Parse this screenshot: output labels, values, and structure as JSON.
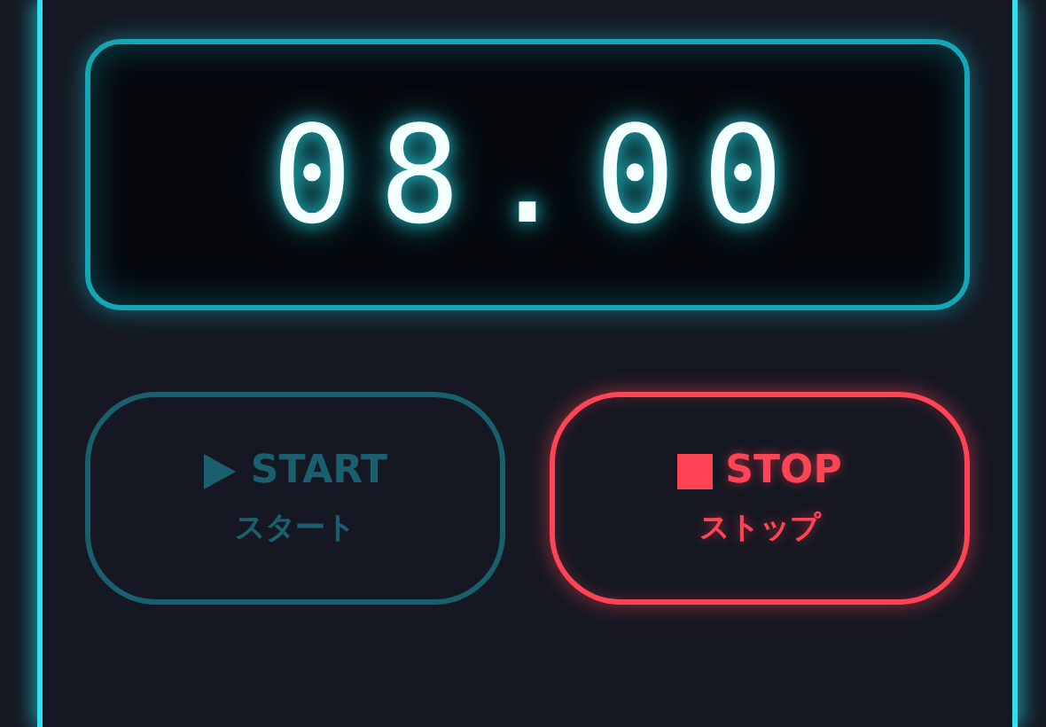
{
  "display": {
    "time": "08.00"
  },
  "buttons": [
    {
      "kind": "start",
      "label": "START",
      "sublabel": "スタート",
      "disabled": true
    },
    {
      "kind": "stop",
      "label": "STOP",
      "sublabel": "ストップ",
      "disabled": false
    }
  ]
}
